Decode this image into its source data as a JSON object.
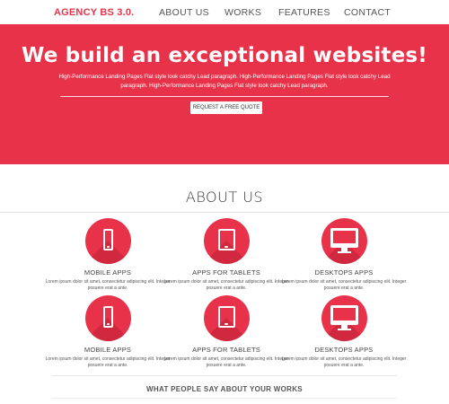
{
  "brand": "AGENCY BS 3.0.",
  "nav": [
    "ABOUT US",
    "WORKS",
    "FEATURES",
    "CONTACT"
  ],
  "hero": {
    "title": "We build an exceptional websites!",
    "lead": "High-Performance Landing Pages Flat style look catchy Lead paragraph. High-Performance Landing Pages Flat style look catchy Lead paragraph. High-Performance Landing Pages Flat style look catchy Lead paragraph.",
    "cta": "REQUEST A FREE QUOTE"
  },
  "about": {
    "title": "ABOUT US",
    "features": [
      {
        "title": "MOBILE APPS",
        "desc": "Lorem ipsum dolor sit amet, consectetur adipiscing elit. Integer posuere erat a ante.",
        "icon": "mobile-phone-icon"
      },
      {
        "title": "APPS FOR TABLETS",
        "desc": "Lorem ipsum dolor sit amet, consectetur adipiscing elit. Integer posuere erat a ante.",
        "icon": "tablet-icon"
      },
      {
        "title": "DESKTOPS APPS",
        "desc": "Lorem ipsum dolor sit amet, consectetur adipiscing elit. Integer posuere erat a ante.",
        "icon": "desktop-monitor-icon"
      },
      {
        "title": "MOBILE APPS",
        "desc": "Lorem ipsum dolor sit amet, consectetur adipiscing elit. Integer posuere erat a ante.",
        "icon": "mobile-phone-icon"
      },
      {
        "title": "APPS FOR TABLETS",
        "desc": "Lorem ipsum dolor sit amet, consectetur adipiscing elit. Integer posuere erat a ante.",
        "icon": "tablet-icon"
      },
      {
        "title": "DESKTOPS APPS",
        "desc": "Lorem ipsum dolor sit amet, consectetur adipiscing elit. Integer posuere erat a ante.",
        "icon": "desktop-monitor-icon"
      }
    ]
  },
  "testimonials": {
    "heading": "WHAT PEOPLE SAY ABOUT YOUR WORKS"
  },
  "colors": {
    "accent": "#e8324a",
    "accent_dark": "#c4243a",
    "text": "#333333"
  }
}
